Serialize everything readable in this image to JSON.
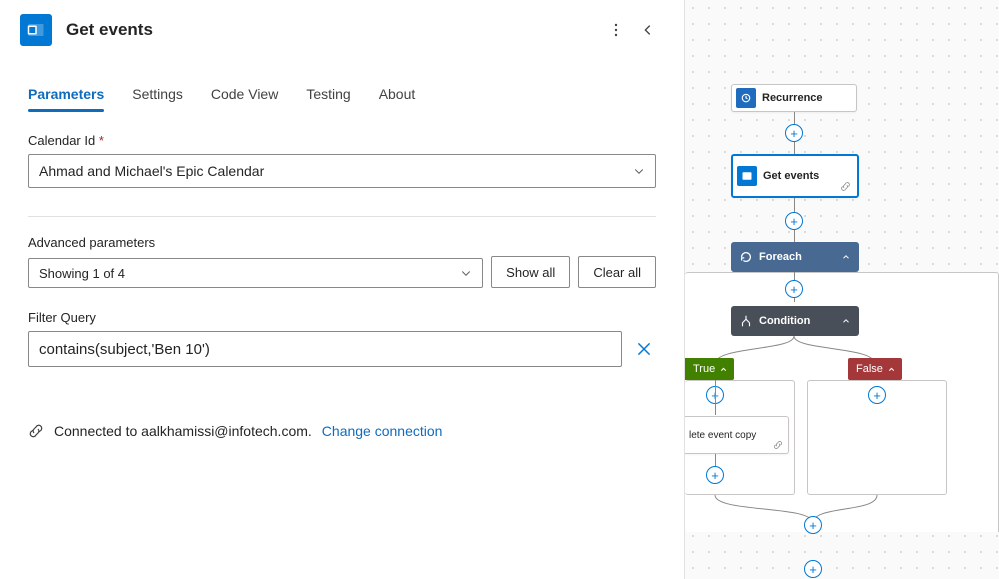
{
  "header": {
    "title": "Get events"
  },
  "tabs": [
    "Parameters",
    "Settings",
    "Code View",
    "Testing",
    "About"
  ],
  "activeTab": "Parameters",
  "fields": {
    "calendarId": {
      "label": "Calendar Id",
      "required": "*",
      "value": "Ahmad and Michael's Epic Calendar"
    },
    "advanced": {
      "label": "Advanced parameters",
      "value": "Showing 1 of 4",
      "showAll": "Show all",
      "clearAll": "Clear all"
    },
    "filterQuery": {
      "label": "Filter Query",
      "value": "contains(subject,'Ben 10')"
    }
  },
  "connection": {
    "text": "Connected to aalkhamissi@infotech.com.",
    "change": "Change connection"
  },
  "flow": {
    "recurrence": "Recurrence",
    "getEvents": "Get events",
    "foreach": "Foreach",
    "condition": "Condition",
    "trueLabel": "True",
    "falseLabel": "False",
    "deleteEvent": "lete event copy"
  },
  "colors": {
    "primary": "#0078d4",
    "foreach": "#486991",
    "condition": "#484f58",
    "true": "#428000",
    "false": "#a4373a"
  }
}
